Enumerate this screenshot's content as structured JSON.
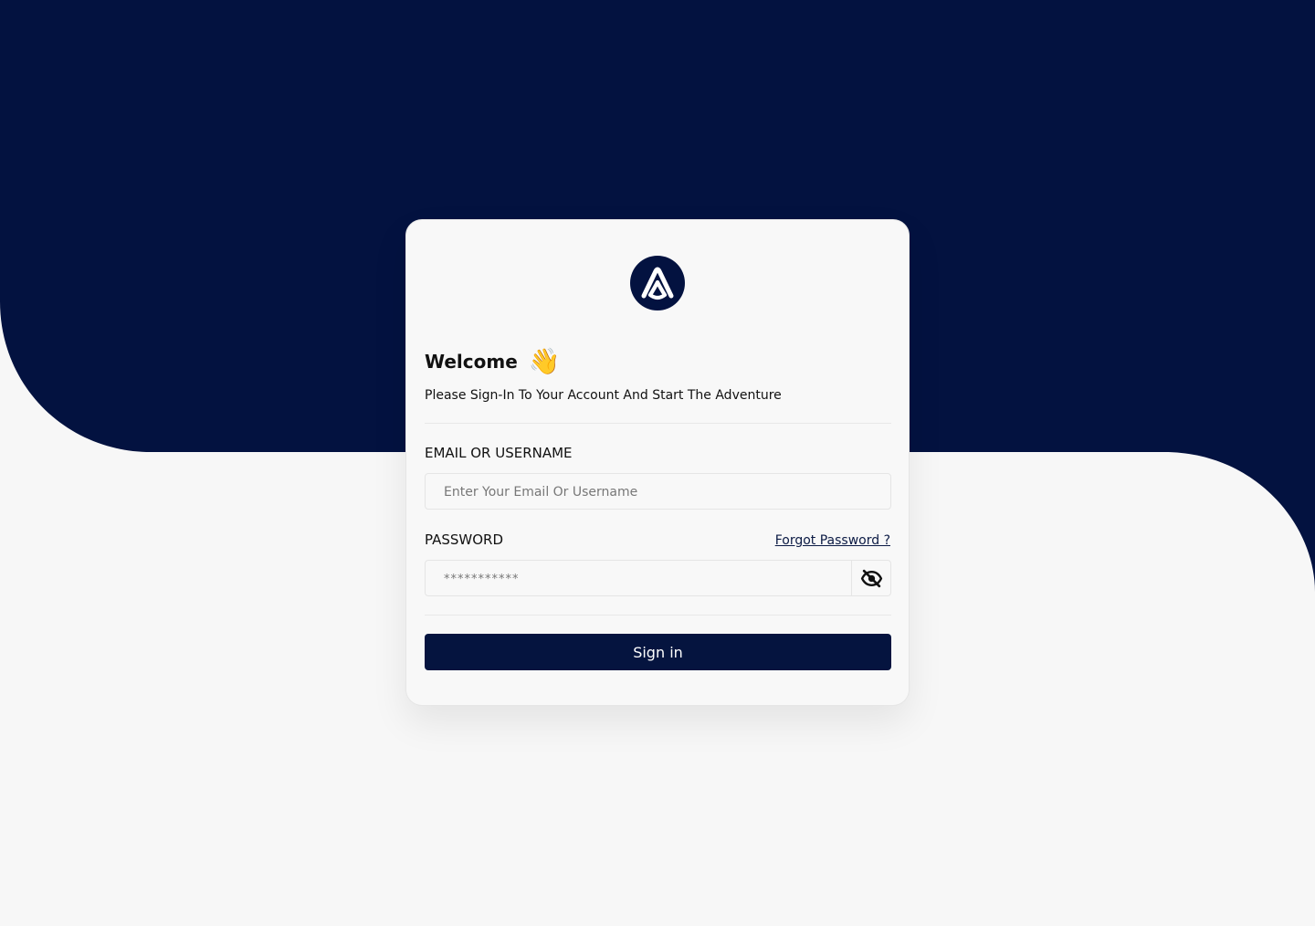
{
  "colors": {
    "navy": "#031240",
    "page_background": "#f7f7f7",
    "card_background": "#f8f8f8",
    "button": "#05143f",
    "text": "#111111"
  },
  "logo": {
    "icon": "brand-logo-icon"
  },
  "welcome": {
    "title": "Welcome",
    "emoji": "👋",
    "subtitle": "Please Sign-In To Your Account And Start The Adventure"
  },
  "form": {
    "email": {
      "label": "EMAIL OR USERNAME",
      "placeholder": "Enter Your Email Or Username"
    },
    "password": {
      "label": "PASSWORD",
      "placeholder": "***********",
      "forgot_label": "Forgot Password ?",
      "toggle_icon": "eye-off-icon"
    },
    "submit_label": "Sign in"
  }
}
